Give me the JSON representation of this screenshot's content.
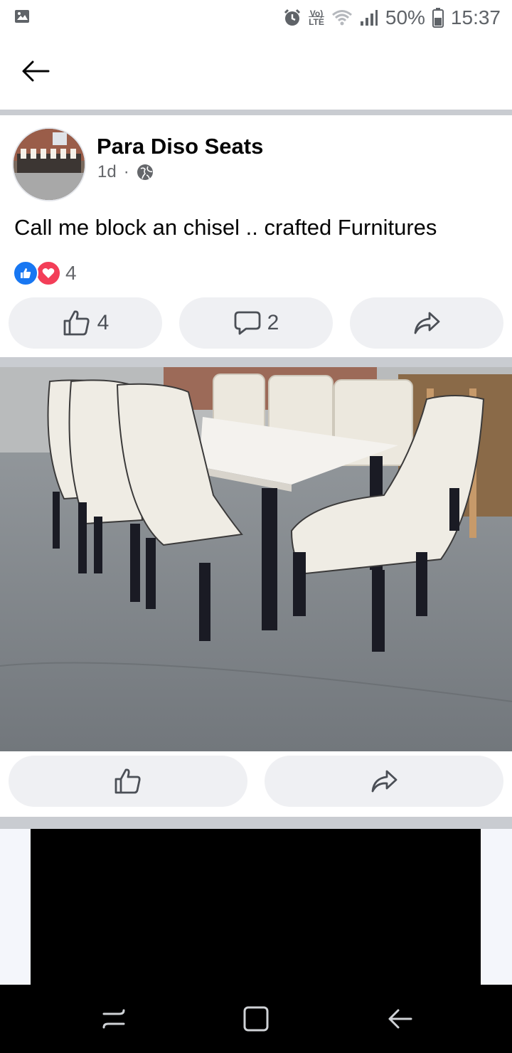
{
  "status_bar": {
    "battery": "50%",
    "time": "15:37",
    "lte_top": "Vo)",
    "lte_bottom": "LTE",
    "icons": [
      "gallery-icon",
      "alarm-icon",
      "volte-icon",
      "wifi-icon",
      "signal-icon",
      "battery-icon"
    ]
  },
  "header": {
    "back_icon": "back-arrow-icon"
  },
  "post": {
    "author": "Para Diso Seats",
    "time": "1d",
    "separator": "·",
    "audience_icon": "globe-icon",
    "text": "Call me block an chisel .. crafted Furnitures",
    "reactions": {
      "icons": [
        "like-reaction-icon",
        "love-reaction-icon"
      ],
      "count": "4"
    },
    "actions": {
      "like_count": "4",
      "comment_count": "2"
    }
  },
  "photo_actions": {
    "icons": [
      "like-icon",
      "share-icon"
    ]
  },
  "nav_bar": {
    "icons": [
      "recents-icon",
      "home-icon",
      "back-icon"
    ]
  },
  "colors": {
    "facebook_blue": "#1877f2",
    "love_red": "#f33e58",
    "pill_bg": "#eff0f3",
    "divider": "#c9ccd1"
  }
}
